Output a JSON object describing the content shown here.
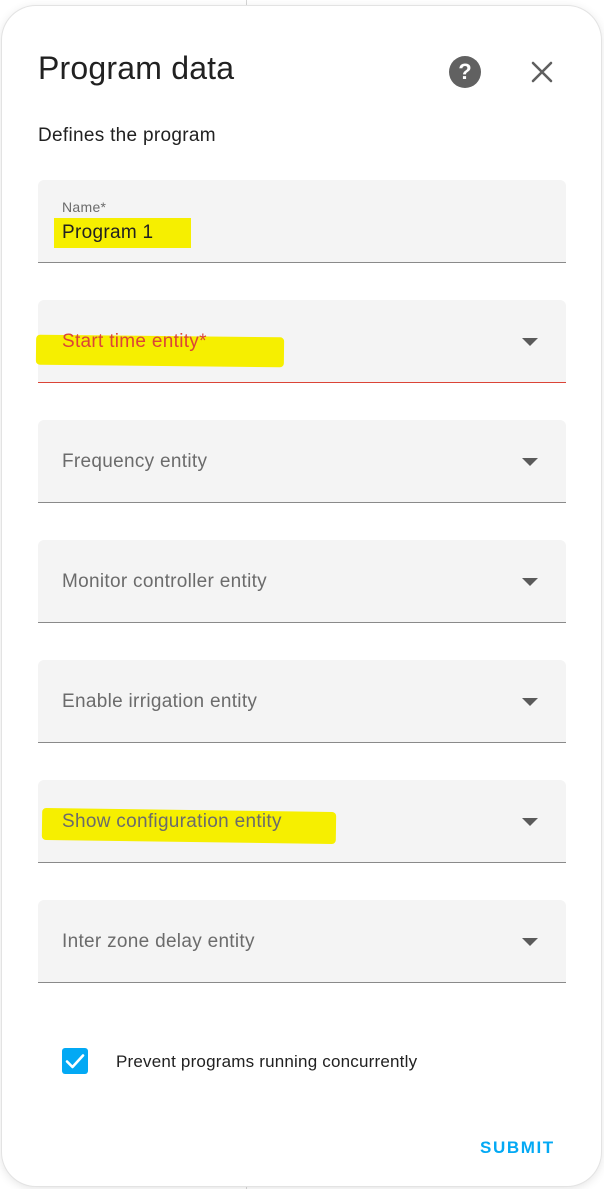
{
  "dialog": {
    "title": "Program data",
    "subtitle": "Defines the program",
    "help_icon": "help-circle-icon",
    "close_icon": "close-icon"
  },
  "fields": {
    "name": {
      "label": "Name*",
      "value": "Program 1"
    },
    "start_time": {
      "label": "Start time entity*"
    },
    "frequency": {
      "label": "Frequency entity"
    },
    "monitor_controller": {
      "label": "Monitor controller entity"
    },
    "enable_irrigation": {
      "label": "Enable irrigation entity"
    },
    "show_configuration": {
      "label": "Show configuration entity"
    },
    "inter_zone_delay": {
      "label": "Inter zone delay entity"
    }
  },
  "options": {
    "prevent_concurrent": {
      "label": "Prevent programs running concurrently",
      "checked": true
    }
  },
  "actions": {
    "submit_label": "SUBMIT"
  },
  "colors": {
    "accent": "#03a9f4",
    "error": "#db4437",
    "highlight": "#f6ef00"
  }
}
